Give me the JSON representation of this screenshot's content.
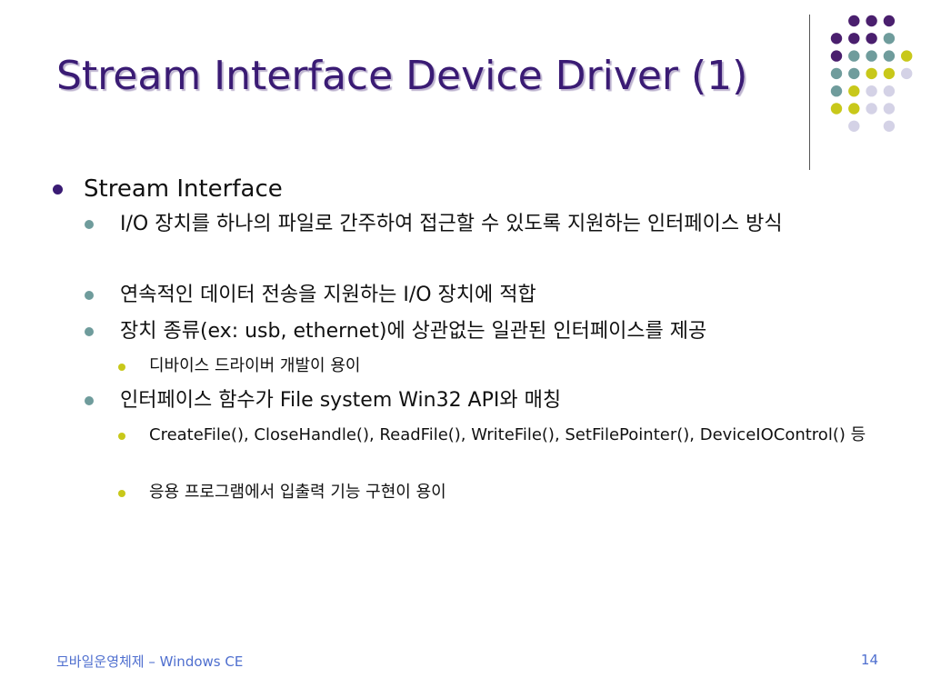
{
  "slide": {
    "title": "Stream Interface Device Driver (1)",
    "bullets": [
      {
        "level": 1,
        "text": "Stream Interface"
      },
      {
        "level": 2,
        "text": "I/O 장치를 하나의 파일로 간주하여 접근할 수 있도록 지원하는 인터페이스 방식"
      },
      {
        "level": 2,
        "text": "연속적인 데이터 전송을 지원하는 I/O 장치에 적합"
      },
      {
        "level": 2,
        "text": "장치 종류(ex: usb, ethernet)에 상관없는 일관된 인터페이스를 제공"
      },
      {
        "level": 3,
        "text": "디바이스 드라이버 개발이 용이"
      },
      {
        "level": 2,
        "text": "인터페이스 함수가 File system Win32 API와 매칭"
      },
      {
        "level": 3,
        "text": "CreateFile(), CloseHandle(), ReadFile(), WriteFile(), SetFilePointer(), DeviceIOControl() 등"
      },
      {
        "level": 3,
        "text": "응용 프로그램에서 입출력 기능 구현이 용이"
      }
    ]
  },
  "footer": {
    "left": "모바일운영체제 – Windows CE",
    "page_number": "14"
  },
  "colors": {
    "title": "#3a1b74",
    "bullet_level1": "#3a1b74",
    "bullet_level2": "#6f9c9c",
    "bullet_level3": "#c8c81a",
    "footer_text": "#4f6fcf",
    "decor_purple": "#4a1f6e",
    "decor_teal": "#6f9c9c",
    "decor_yellow": "#c8c81a",
    "decor_lavender": "#d4d2e6"
  }
}
